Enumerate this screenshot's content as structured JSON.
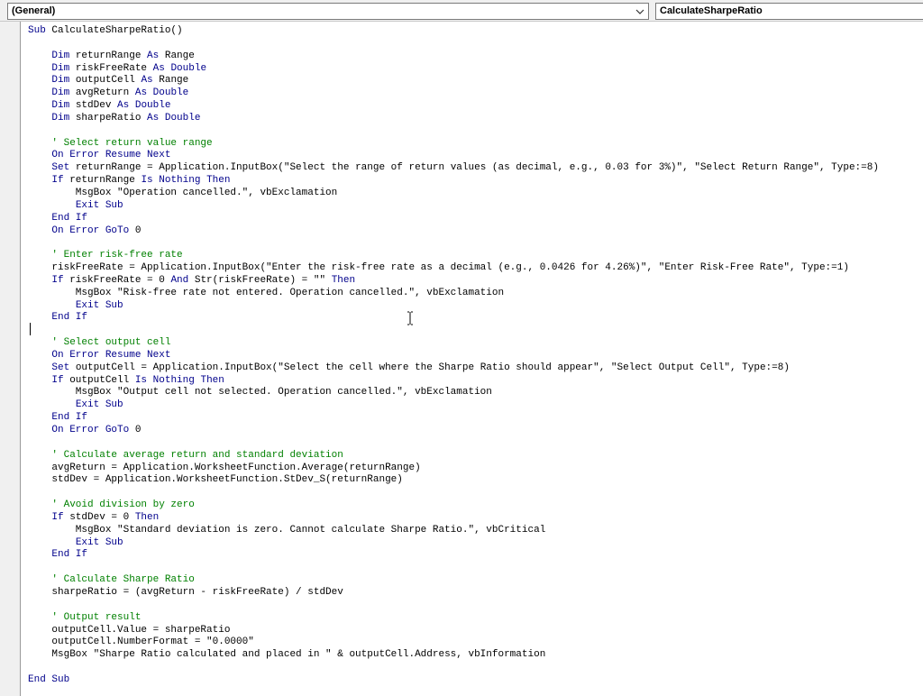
{
  "toolbar": {
    "object_combo": "(General)",
    "procedure_combo": "CalculateSharpeRatio"
  },
  "code_lines": [
    [
      [
        "k",
        "Sub"
      ],
      [
        "t",
        " CalculateSharpeRatio()"
      ]
    ],
    [],
    [
      [
        "t",
        "    "
      ],
      [
        "k",
        "Dim"
      ],
      [
        "t",
        " returnRange "
      ],
      [
        "k",
        "As"
      ],
      [
        "t",
        " Range"
      ]
    ],
    [
      [
        "t",
        "    "
      ],
      [
        "k",
        "Dim"
      ],
      [
        "t",
        " riskFreeRate "
      ],
      [
        "k",
        "As"
      ],
      [
        "t",
        " "
      ],
      [
        "k",
        "Double"
      ]
    ],
    [
      [
        "t",
        "    "
      ],
      [
        "k",
        "Dim"
      ],
      [
        "t",
        " outputCell "
      ],
      [
        "k",
        "As"
      ],
      [
        "t",
        " Range"
      ]
    ],
    [
      [
        "t",
        "    "
      ],
      [
        "k",
        "Dim"
      ],
      [
        "t",
        " avgReturn "
      ],
      [
        "k",
        "As"
      ],
      [
        "t",
        " "
      ],
      [
        "k",
        "Double"
      ]
    ],
    [
      [
        "t",
        "    "
      ],
      [
        "k",
        "Dim"
      ],
      [
        "t",
        " stdDev "
      ],
      [
        "k",
        "As"
      ],
      [
        "t",
        " "
      ],
      [
        "k",
        "Double"
      ]
    ],
    [
      [
        "t",
        "    "
      ],
      [
        "k",
        "Dim"
      ],
      [
        "t",
        " sharpeRatio "
      ],
      [
        "k",
        "As"
      ],
      [
        "t",
        " "
      ],
      [
        "k",
        "Double"
      ]
    ],
    [],
    [
      [
        "c",
        "    ' Select return value range"
      ]
    ],
    [
      [
        "t",
        "    "
      ],
      [
        "k",
        "On Error Resume Next"
      ]
    ],
    [
      [
        "t",
        "    "
      ],
      [
        "k",
        "Set"
      ],
      [
        "t",
        " returnRange = Application.InputBox(\"Select the range of return values (as decimal, e.g., 0.03 for 3%)\", \"Select Return Range\", Type:=8)"
      ]
    ],
    [
      [
        "t",
        "    "
      ],
      [
        "k",
        "If"
      ],
      [
        "t",
        " returnRange "
      ],
      [
        "k",
        "Is"
      ],
      [
        "t",
        " "
      ],
      [
        "k",
        "Nothing"
      ],
      [
        "t",
        " "
      ],
      [
        "k",
        "Then"
      ]
    ],
    [
      [
        "t",
        "        MsgBox \"Operation cancelled.\", vbExclamation"
      ]
    ],
    [
      [
        "t",
        "        "
      ],
      [
        "k",
        "Exit Sub"
      ]
    ],
    [
      [
        "t",
        "    "
      ],
      [
        "k",
        "End If"
      ]
    ],
    [
      [
        "t",
        "    "
      ],
      [
        "k",
        "On Error GoTo"
      ],
      [
        "t",
        " 0"
      ]
    ],
    [],
    [
      [
        "c",
        "    ' Enter risk-free rate"
      ]
    ],
    [
      [
        "t",
        "    riskFreeRate = Application.InputBox(\"Enter the risk-free rate as a decimal (e.g., 0.0426 for 4.26%)\", \"Enter Risk-Free Rate\", Type:=1)"
      ]
    ],
    [
      [
        "t",
        "    "
      ],
      [
        "k",
        "If"
      ],
      [
        "t",
        " riskFreeRate = 0 "
      ],
      [
        "k",
        "And"
      ],
      [
        "t",
        " Str(riskFreeRate) = \"\" "
      ],
      [
        "k",
        "Then"
      ]
    ],
    [
      [
        "t",
        "        MsgBox \"Risk-free rate not entered. Operation cancelled.\", vbExclamation"
      ]
    ],
    [
      [
        "t",
        "        "
      ],
      [
        "k",
        "Exit Sub"
      ]
    ],
    [
      [
        "t",
        "    "
      ],
      [
        "k",
        "End If"
      ]
    ],
    [],
    [
      [
        "c",
        "    ' Select output cell"
      ]
    ],
    [
      [
        "t",
        "    "
      ],
      [
        "k",
        "On Error Resume Next"
      ]
    ],
    [
      [
        "t",
        "    "
      ],
      [
        "k",
        "Set"
      ],
      [
        "t",
        " outputCell = Application.InputBox(\"Select the cell where the Sharpe Ratio should appear\", \"Select Output Cell\", Type:=8)"
      ]
    ],
    [
      [
        "t",
        "    "
      ],
      [
        "k",
        "If"
      ],
      [
        "t",
        " outputCell "
      ],
      [
        "k",
        "Is"
      ],
      [
        "t",
        " "
      ],
      [
        "k",
        "Nothing"
      ],
      [
        "t",
        " "
      ],
      [
        "k",
        "Then"
      ]
    ],
    [
      [
        "t",
        "        MsgBox \"Output cell not selected. Operation cancelled.\", vbExclamation"
      ]
    ],
    [
      [
        "t",
        "        "
      ],
      [
        "k",
        "Exit Sub"
      ]
    ],
    [
      [
        "t",
        "    "
      ],
      [
        "k",
        "End If"
      ]
    ],
    [
      [
        "t",
        "    "
      ],
      [
        "k",
        "On Error GoTo"
      ],
      [
        "t",
        " 0"
      ]
    ],
    [],
    [
      [
        "c",
        "    ' Calculate average return and standard deviation"
      ]
    ],
    [
      [
        "t",
        "    avgReturn = Application.WorksheetFunction.Average(returnRange)"
      ]
    ],
    [
      [
        "t",
        "    stdDev = Application.WorksheetFunction.StDev_S(returnRange)"
      ]
    ],
    [],
    [
      [
        "c",
        "    ' Avoid division by zero"
      ]
    ],
    [
      [
        "t",
        "    "
      ],
      [
        "k",
        "If"
      ],
      [
        "t",
        " stdDev = 0 "
      ],
      [
        "k",
        "Then"
      ]
    ],
    [
      [
        "t",
        "        MsgBox \"Standard deviation is zero. Cannot calculate Sharpe Ratio.\", vbCritical"
      ]
    ],
    [
      [
        "t",
        "        "
      ],
      [
        "k",
        "Exit Sub"
      ]
    ],
    [
      [
        "t",
        "    "
      ],
      [
        "k",
        "End If"
      ]
    ],
    [],
    [
      [
        "c",
        "    ' Calculate Sharpe Ratio"
      ]
    ],
    [
      [
        "t",
        "    sharpeRatio = (avgReturn - riskFreeRate) / stdDev"
      ]
    ],
    [],
    [
      [
        "c",
        "    ' Output result"
      ]
    ],
    [
      [
        "t",
        "    outputCell.Value = sharpeRatio"
      ]
    ],
    [
      [
        "t",
        "    outputCell.NumberFormat = \"0.0000\""
      ]
    ],
    [
      [
        "t",
        "    MsgBox \"Sharpe Ratio calculated and placed in \" & outputCell.Address, vbInformation"
      ]
    ],
    [],
    [
      [
        "k",
        "End Sub"
      ]
    ]
  ]
}
